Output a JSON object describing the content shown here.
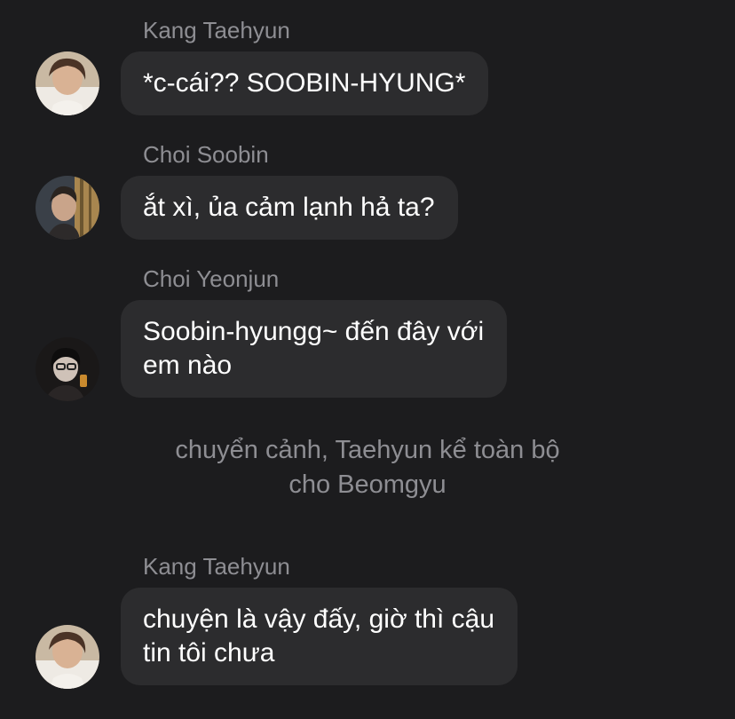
{
  "messages": [
    {
      "sender": "Kang Taehyun",
      "text": "*c-cái?? SOOBIN-HYUNG*",
      "avatar_icon": "avatar-taehyun"
    },
    {
      "sender": "Choi Soobin",
      "text": "ắt xì, ủa cảm lạnh hả ta?",
      "avatar_icon": "avatar-soobin"
    },
    {
      "sender": "Choi Yeonjun",
      "text": "Soobin-hyungg~ đến đây với\nem nào",
      "avatar_icon": "avatar-yeonjun"
    },
    {
      "sender": "Kang Taehyun",
      "text": "chuyện là vậy đấy, giờ thì cậu\ntin tôi chưa",
      "avatar_icon": "avatar-taehyun"
    }
  ],
  "narration": "chuyển cảnh, Taehyun kể toàn bộ\ncho Beomgyu",
  "colors": {
    "background": "#1c1c1e",
    "bubble": "#2c2c2e",
    "name_text": "#8e8e93",
    "message_text": "#ffffff"
  }
}
